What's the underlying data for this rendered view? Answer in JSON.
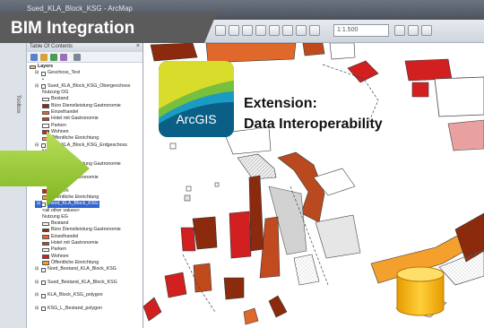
{
  "window": {
    "title": "Sued_KLA_Block_KSG - ArcMap",
    "scale": "1:1.500"
  },
  "banner": {
    "title": "BIM Integration"
  },
  "extension": {
    "line1": "Extension:",
    "line2": "Data Interoperability"
  },
  "arcgis_logo": {
    "text": "ArcGIS",
    "colors": [
      "#0b5f86",
      "#1a9bc4",
      "#77bf3e",
      "#d9dc2a"
    ]
  },
  "side_tab": {
    "label": "Toolbox"
  },
  "toc": {
    "title": "Table Of Contents",
    "close": "×",
    "rows": [
      {
        "indent": 0,
        "checkbox": false,
        "swatch": null,
        "text": "Layers",
        "bold": true
      },
      {
        "indent": 1,
        "checkbox": true,
        "swatch": null,
        "text": "Geschoss_Text"
      },
      {
        "indent": 2,
        "checkbox": false,
        "swatch": null,
        "text": "•"
      },
      {
        "indent": 1,
        "checkbox": true,
        "swatch": null,
        "text": "Sued_KLA_Block_KSG_Obergeschoss"
      },
      {
        "indent": 2,
        "checkbox": false,
        "swatch": null,
        "text": "Nutzung OG"
      },
      {
        "indent": 2,
        "checkbox": false,
        "swatch": "#ffffff",
        "text": "Bestand"
      },
      {
        "indent": 2,
        "checkbox": false,
        "swatch": "#8b2a0c",
        "text": "Büro Dienstleistung Gastronomie"
      },
      {
        "indent": 2,
        "checkbox": false,
        "swatch": "#e0682a",
        "text": "Einzelhandel"
      },
      {
        "indent": 2,
        "checkbox": false,
        "swatch": "#b94a1f",
        "text": "Hotel mit Gastronomie"
      },
      {
        "indent": 2,
        "checkbox": false,
        "swatch": "#ffffff",
        "text": "Parken"
      },
      {
        "indent": 2,
        "checkbox": false,
        "swatch": "#d21f1f",
        "text": "Wohnen"
      },
      {
        "indent": 2,
        "checkbox": false,
        "swatch": "#f4a02c",
        "text": "Öffentliche Einrichtung"
      },
      {
        "indent": 1,
        "checkbox": true,
        "swatch": null,
        "text": "Sued_KLA_Block_KSG_Erdgeschoss"
      },
      {
        "indent": 2,
        "checkbox": false,
        "swatch": null,
        "text": "Nutzung EG"
      },
      {
        "indent": 2,
        "checkbox": false,
        "swatch": "#ffffff",
        "text": "Bestand"
      },
      {
        "indent": 2,
        "checkbox": false,
        "swatch": "#8b2a0c",
        "text": "Büro Dienstleistung Gastronomie"
      },
      {
        "indent": 2,
        "checkbox": false,
        "swatch": "#e0682a",
        "text": "Einzelhandel"
      },
      {
        "indent": 2,
        "checkbox": false,
        "swatch": "#b94a1f",
        "text": "Hotel mit Gastronomie"
      },
      {
        "indent": 2,
        "checkbox": false,
        "swatch": "#ffffff",
        "text": "Parken"
      },
      {
        "indent": 2,
        "checkbox": false,
        "swatch": "#d21f1f",
        "text": "Wohnen"
      },
      {
        "indent": 2,
        "checkbox": false,
        "swatch": "#f4a02c",
        "text": "Öffentliche Einrichtung"
      },
      {
        "indent": 1,
        "checkbox": true,
        "swatch": null,
        "text": "Nord_KLA_Block_KSG",
        "selected": true
      },
      {
        "indent": 2,
        "checkbox": false,
        "swatch": null,
        "text": "<all other values>"
      },
      {
        "indent": 2,
        "checkbox": false,
        "swatch": null,
        "text": "Nutzung EG"
      },
      {
        "indent": 2,
        "checkbox": false,
        "swatch": "#ffffff",
        "text": "Bestand"
      },
      {
        "indent": 2,
        "checkbox": false,
        "swatch": "#8b2a0c",
        "text": "Büro Dienstleistung Gastronomie"
      },
      {
        "indent": 2,
        "checkbox": false,
        "swatch": "#e0682a",
        "text": "Einzelhandel"
      },
      {
        "indent": 2,
        "checkbox": false,
        "swatch": "#b94a1f",
        "text": "Hotel mit Gastronomie"
      },
      {
        "indent": 2,
        "checkbox": false,
        "swatch": "#ffffff",
        "text": "Parken"
      },
      {
        "indent": 2,
        "checkbox": false,
        "swatch": "#d21f1f",
        "text": "Wohnen"
      },
      {
        "indent": 2,
        "checkbox": false,
        "swatch": "#f4a02c",
        "text": "Öffentliche Einrichtung"
      },
      {
        "indent": 1,
        "checkbox": true,
        "swatch": null,
        "text": "Nord_Bestand_KLA_Block_KSG"
      },
      {
        "indent": 2,
        "checkbox": false,
        "swatch": null,
        "text": ""
      },
      {
        "indent": 1,
        "checkbox": true,
        "swatch": null,
        "text": "Sued_Bestand_KLA_Block_KSG"
      },
      {
        "indent": 2,
        "checkbox": false,
        "swatch": null,
        "text": ""
      },
      {
        "indent": 1,
        "checkbox": true,
        "swatch": null,
        "text": "KLA_Block_KSG_polygon"
      },
      {
        "indent": 2,
        "checkbox": false,
        "swatch": null,
        "text": ""
      },
      {
        "indent": 1,
        "checkbox": true,
        "swatch": null,
        "text": "KSG_L_Bestand_polygon"
      }
    ]
  }
}
